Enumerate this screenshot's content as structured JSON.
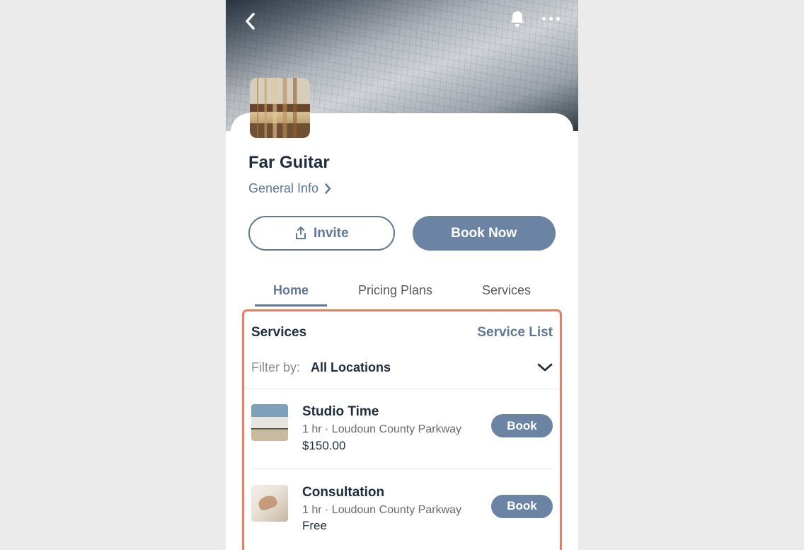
{
  "business": {
    "name": "Far Guitar",
    "general_info_label": "General Info"
  },
  "actions": {
    "invite": "Invite",
    "book_now": "Book Now"
  },
  "tabs": [
    {
      "label": "Home",
      "active": true
    },
    {
      "label": "Pricing Plans",
      "active": false
    },
    {
      "label": "Services",
      "active": false
    }
  ],
  "services_section": {
    "title": "Services",
    "list_link": "Service List",
    "filter_label": "Filter by:",
    "filter_value": "All Locations"
  },
  "services": [
    {
      "name": "Studio Time",
      "meta": "1 hr · Loudoun County Parkway",
      "price": "$150.00",
      "book_label": "Book",
      "thumb_class": "thumb-studio"
    },
    {
      "name": "Consultation",
      "meta": "1 hr · Loudoun County Parkway",
      "price": "Free",
      "book_label": "Book",
      "thumb_class": "thumb-consult"
    }
  ]
}
